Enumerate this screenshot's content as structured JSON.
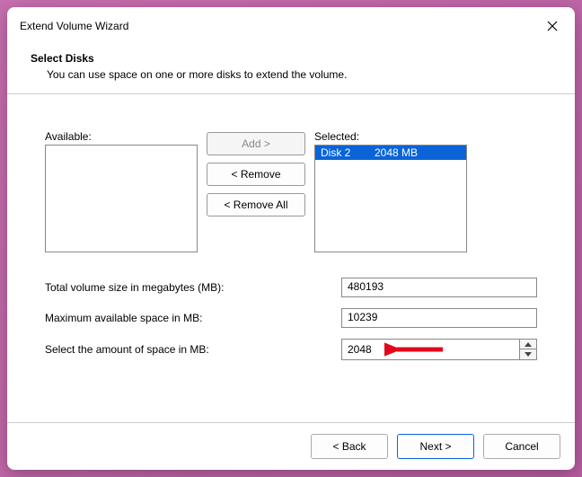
{
  "window": {
    "title": "Extend Volume Wizard"
  },
  "header": {
    "title": "Select Disks",
    "subtitle": "You can use space on one or more disks to extend the volume."
  },
  "lists": {
    "available_label": "Available:",
    "selected_label": "Selected:",
    "selected_items": [
      {
        "name": "Disk 2",
        "size": "2048 MB"
      }
    ]
  },
  "buttons": {
    "add": "Add >",
    "remove": "< Remove",
    "remove_all": "< Remove All",
    "back": "< Back",
    "next": "Next >",
    "cancel": "Cancel"
  },
  "info": {
    "total_label": "Total volume size in megabytes (MB):",
    "total_value": "480193",
    "max_label": "Maximum available space in MB:",
    "max_value": "10239",
    "select_label": "Select the amount of space in MB:",
    "select_value": "2048"
  }
}
